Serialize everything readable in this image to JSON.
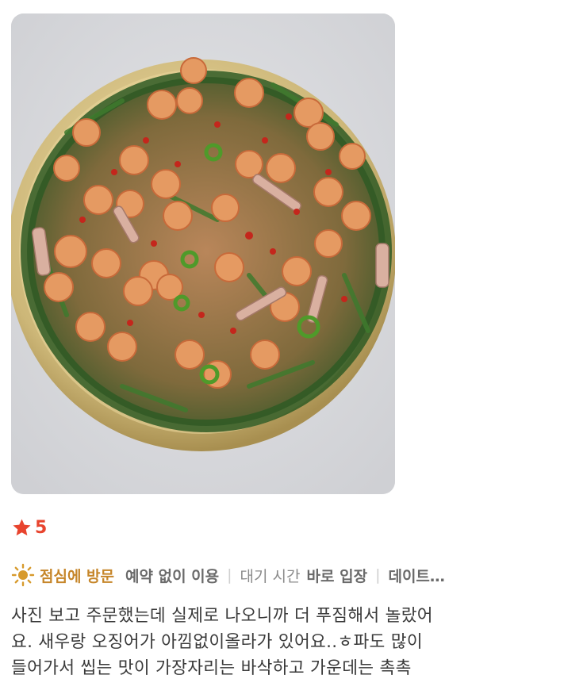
{
  "review_photo": {
    "alt_icon": "seafood-pancake-photo"
  },
  "rating": {
    "icon": "star-icon",
    "value": "5",
    "color": "#e8442e"
  },
  "visit_tags": {
    "visit_icon": "sun-icon",
    "visit_time": "점심에 방문",
    "reservation": "예약 없이 이용",
    "wait_label": "대기 시간",
    "wait_value": "바로 입장",
    "purpose": "데이트…"
  },
  "review": {
    "lines": [
      "사진 보고 주문했는데 실제로 나오니까 더 푸짐해서 놀랐어",
      "요. 새우랑 오징어가 아낌없이올라가 있어요..ㅎ파도 많이",
      "들어가서 씹는 맛이 가장자리는 바삭하고 가운데는 촉촉"
    ]
  }
}
